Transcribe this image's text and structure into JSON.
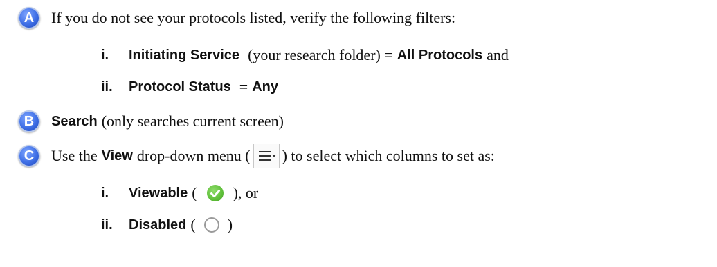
{
  "items": {
    "a": {
      "badge": "A",
      "text": "If you do not see your protocols listed, verify the following filters:",
      "sub": [
        {
          "num": "i.",
          "label": "Initiating Service",
          "mid": "(your research folder) =",
          "value": "All Protocols",
          "tail": "and"
        },
        {
          "num": "ii.",
          "label": "Protocol Status",
          "mid": "=",
          "value": "Any"
        }
      ]
    },
    "b": {
      "badge": "B",
      "label": "Search",
      "text": "(only searches current screen)"
    },
    "c": {
      "badge": "C",
      "pre": "Use the",
      "label": "View",
      "mid": "drop-down menu (",
      "post": ") to select which columns to set as:",
      "menu_icon": "menu-dropdown-icon",
      "sub": [
        {
          "num": "i.",
          "label": "Viewable",
          "open": "(",
          "close": "), or",
          "icon": "green-check-icon",
          "icon_color": "#5fbf3a"
        },
        {
          "num": "ii.",
          "label": "Disabled",
          "open": "(",
          "close": ")",
          "icon": "empty-circle-icon"
        }
      ]
    }
  },
  "colors": {
    "badge": "#3f6fe6",
    "text": "#111111"
  }
}
